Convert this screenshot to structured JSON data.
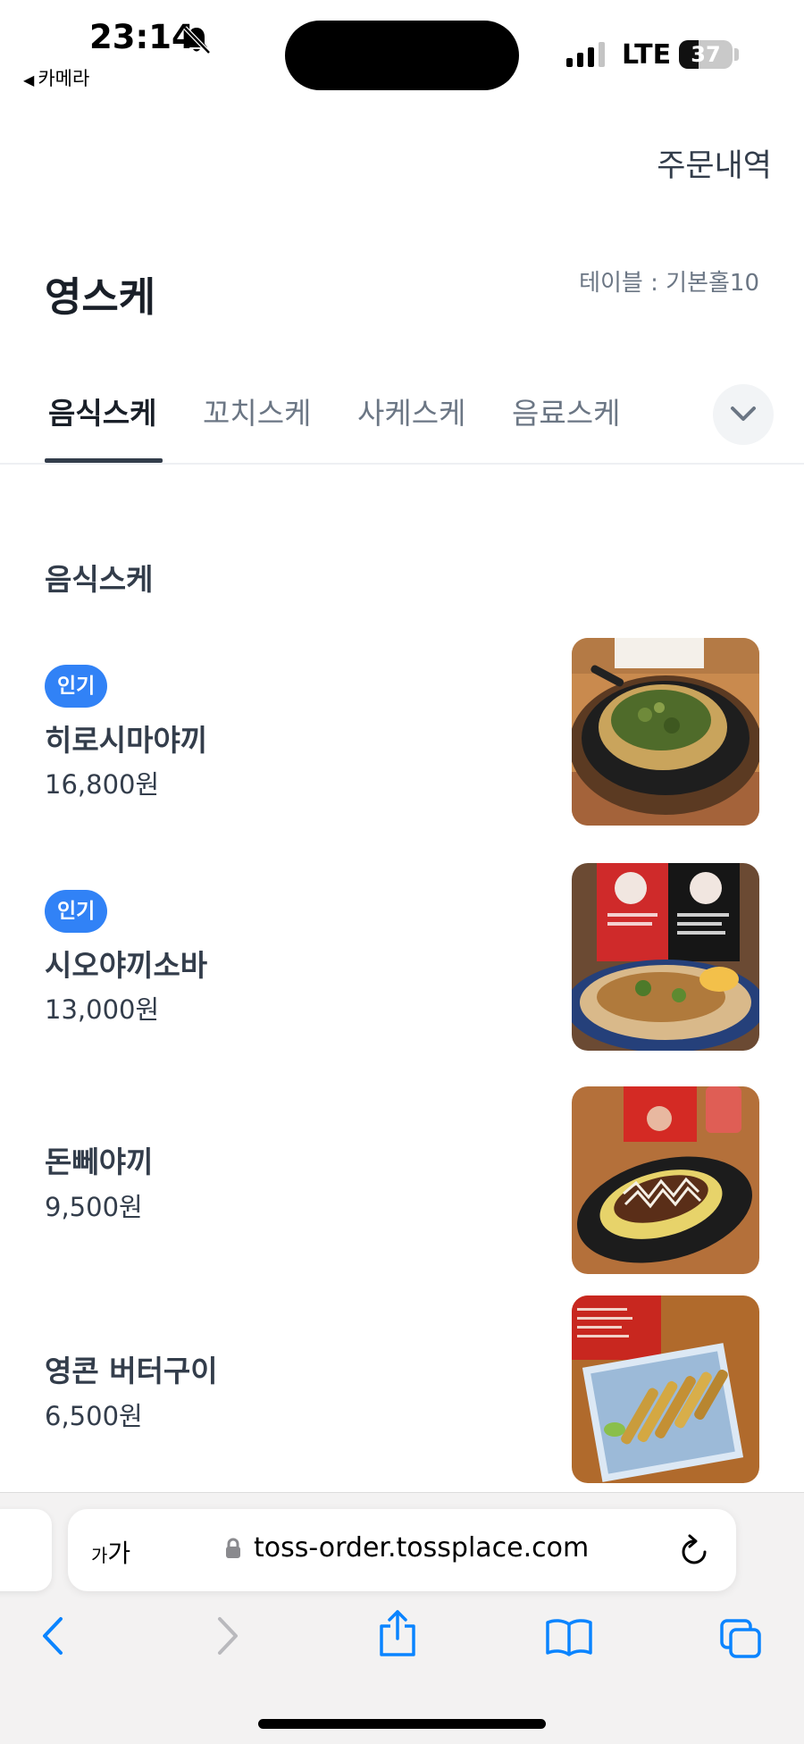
{
  "status_bar": {
    "time": "23:14",
    "back_app": "카메라",
    "network": "LTE",
    "battery": "37",
    "battery_level": 0.37
  },
  "header": {
    "order_history": "주문내역",
    "store_name": "영스케",
    "table_info": "테이블 : 기본홀10"
  },
  "tabs": [
    {
      "label": "음식스케",
      "active": true
    },
    {
      "label": "꼬치스케",
      "active": false
    },
    {
      "label": "사케스케",
      "active": false
    },
    {
      "label": "음료스케",
      "active": false
    }
  ],
  "section": {
    "title": "음식스케"
  },
  "menu_items": [
    {
      "badge": "인기",
      "name": "히로시마야끼",
      "price": "16,800원"
    },
    {
      "badge": "인기",
      "name": "시오야끼소바",
      "price": "13,000원"
    },
    {
      "name": "돈뻬야끼",
      "price": "9,500원"
    },
    {
      "name": "영콘 버터구이",
      "price": "6,500원"
    }
  ],
  "browser": {
    "text_size_small": "가",
    "text_size_large": "가",
    "url": "toss-order.tossplace.com"
  },
  "colors": {
    "accent": "#3182f6",
    "text_primary": "#333d4b",
    "text_secondary": "#6b7684",
    "ios_blue": "#0a84ff"
  }
}
